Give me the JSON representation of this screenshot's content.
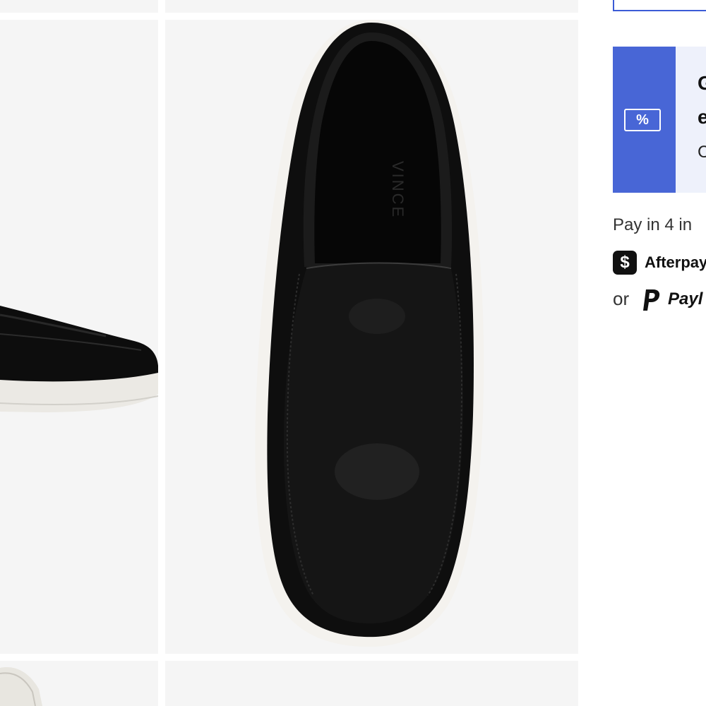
{
  "gallery": {
    "images": [
      {
        "icon": "shoe-side-view-image"
      },
      {
        "icon": "shoe-top-view-image"
      },
      {
        "icon": "shoe-sole-view-image"
      }
    ],
    "brand_imprint": "VINCE"
  },
  "promo": {
    "icon_glyph": "%",
    "line1": "G",
    "line2": "e",
    "line3": "C",
    "accent_color": "#4866d6",
    "background_color": "#eef1fb"
  },
  "payment": {
    "installments_text": "Pay in 4 in",
    "afterpay_glyph": "$",
    "afterpay_label": "Afterpay",
    "or_text": "or",
    "paypal_label": "Payl"
  }
}
